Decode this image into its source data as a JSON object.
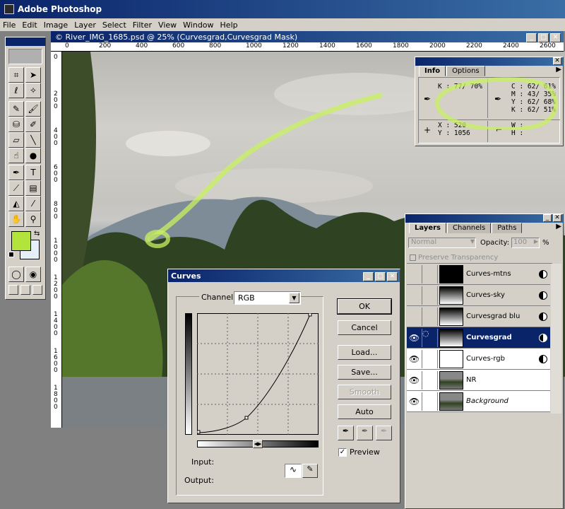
{
  "app": {
    "title": "Adobe Photoshop"
  },
  "menu": [
    "File",
    "Edit",
    "Image",
    "Layer",
    "Select",
    "Filter",
    "View",
    "Window",
    "Help"
  ],
  "document": {
    "title": "© River_IMG_1685.psd @ 25% (Curvesgrad,Curvesgrad Mask)",
    "hruler": [
      "0",
      "200",
      "400",
      "600",
      "800",
      "1000",
      "1200",
      "1400",
      "1600",
      "1800",
      "2000",
      "2200",
      "2400",
      "2600"
    ],
    "vruler": [
      "0",
      "200",
      "400",
      "600",
      "800",
      "1000",
      "1200",
      "1400",
      "1600",
      "1800"
    ]
  },
  "info": {
    "tabs": [
      "Info",
      "Options"
    ],
    "k_left": "K :  77/ 70%",
    "c": "C :  62/ 61%",
    "m": "M :  43/ 35%",
    "y": "Y :  62/ 68%",
    "k": "K :  62/ 51%",
    "x": "X :    520",
    "yy": "Y :   1056",
    "w": "W :",
    "h": "H :"
  },
  "layers": {
    "tabs": [
      "Layers",
      "Channels",
      "Paths"
    ],
    "blend_mode": "Normal",
    "opacity_label": "Opacity:",
    "opacity_value": "100",
    "opacity_unit": "%",
    "preserve": "Preserve Transparency",
    "items": [
      {
        "name": "Curves-mtns",
        "visible": false
      },
      {
        "name": "Curves-sky",
        "visible": false
      },
      {
        "name": "Curvesgrad blu",
        "visible": false
      },
      {
        "name": "Curvesgrad",
        "visible": true
      },
      {
        "name": "Curves-rgb",
        "visible": true
      },
      {
        "name": "NR",
        "visible": true
      },
      {
        "name": "Background",
        "visible": true
      }
    ]
  },
  "curves": {
    "title": "Curves",
    "channel_label": "Channel:",
    "channel_value": "RGB",
    "ok": "OK",
    "cancel": "Cancel",
    "load": "Load...",
    "save": "Save...",
    "smooth": "Smooth",
    "auto": "Auto",
    "preview": "Preview",
    "preview_checked": true,
    "input_label": "Input:",
    "output_label": "Output:"
  },
  "colors": {
    "foreground": "#b2e43c",
    "background": "#e6f0f8",
    "highlight": "#c8f060"
  }
}
